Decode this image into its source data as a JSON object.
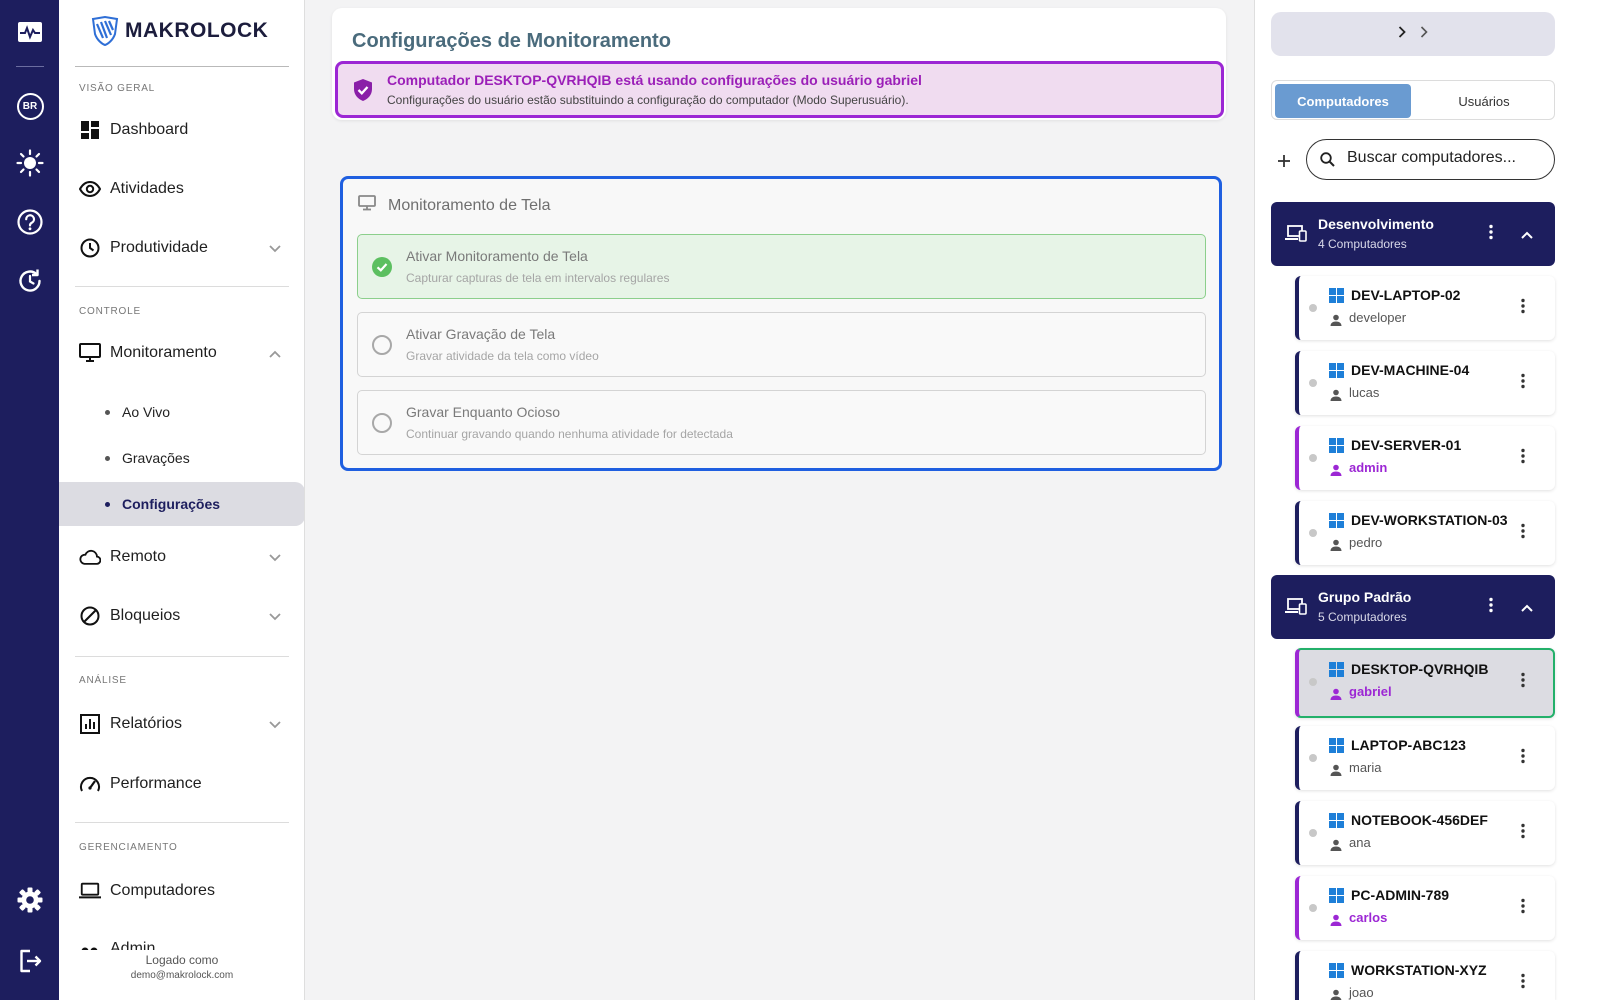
{
  "brand": {
    "name": "MAKROLOCK"
  },
  "rail": {
    "lang": "BR"
  },
  "nav": {
    "sections": {
      "overview": "VISÃO GERAL",
      "control": "CONTROLE",
      "analysis": "ANÁLISE",
      "management": "GERENCIAMENTO"
    },
    "items": {
      "dashboard": "Dashboard",
      "activities": "Atividades",
      "productivity": "Produtividade",
      "monitoring": "Monitoramento",
      "remote": "Remoto",
      "blocks": "Bloqueios",
      "reports": "Relatórios",
      "performance": "Performance",
      "computers": "Computadores",
      "admin": "Admin"
    },
    "monitoring_sub": {
      "live": "Ao Vivo",
      "recordings": "Gravações",
      "settings": "Configurações"
    },
    "footer": {
      "logged_as": "Logado como",
      "email": "demo@makrolock.com"
    }
  },
  "main": {
    "title": "Configurações de Monitoramento",
    "banner": {
      "title": "Computador DESKTOP-QVRHQIB está usando configurações do usuário gabriel",
      "subtitle": "Configurações do usuário estão substituindo a configuração do computador (Modo Superusuário)."
    },
    "screen_card": {
      "title": "Monitoramento de Tela",
      "options": [
        {
          "title": "Ativar Monitoramento de Tela",
          "desc": "Capturar capturas de tela em intervalos regulares",
          "enabled": true
        },
        {
          "title": "Ativar Gravação de Tela",
          "desc": "Gravar atividade da tela como vídeo",
          "enabled": false
        },
        {
          "title": "Gravar Enquanto Ocioso",
          "desc": "Continuar gravando quando nenhuma atividade for detectada",
          "enabled": false
        }
      ]
    }
  },
  "right": {
    "tabs": {
      "computers": "Computadores",
      "users": "Usuários"
    },
    "search": {
      "placeholder": "Buscar computadores..."
    },
    "groups": [
      {
        "name": "Desenvolvimento",
        "count": "4 Computadores"
      },
      {
        "name": "Grupo Padrão",
        "count": "5 Computadores"
      }
    ],
    "computers": [
      {
        "name": "DEV-LAPTOP-02",
        "user": "developer"
      },
      {
        "name": "DEV-MACHINE-04",
        "user": "lucas"
      },
      {
        "name": "DEV-SERVER-01",
        "user": "admin"
      },
      {
        "name": "DEV-WORKSTATION-03",
        "user": "pedro"
      },
      {
        "name": "DESKTOP-QVRHQIB",
        "user": "gabriel"
      },
      {
        "name": "LAPTOP-ABC123",
        "user": "maria"
      },
      {
        "name": "NOTEBOOK-456DEF",
        "user": "ana"
      },
      {
        "name": "PC-ADMIN-789",
        "user": "carlos"
      },
      {
        "name": "WORKSTATION-XYZ",
        "user": "joao"
      }
    ]
  },
  "colors": {
    "navy": "#1d1e5e",
    "accent_blue": "#1f5fe0",
    "superuser_purple": "#9c27d4",
    "success_green": "#23b06a"
  }
}
